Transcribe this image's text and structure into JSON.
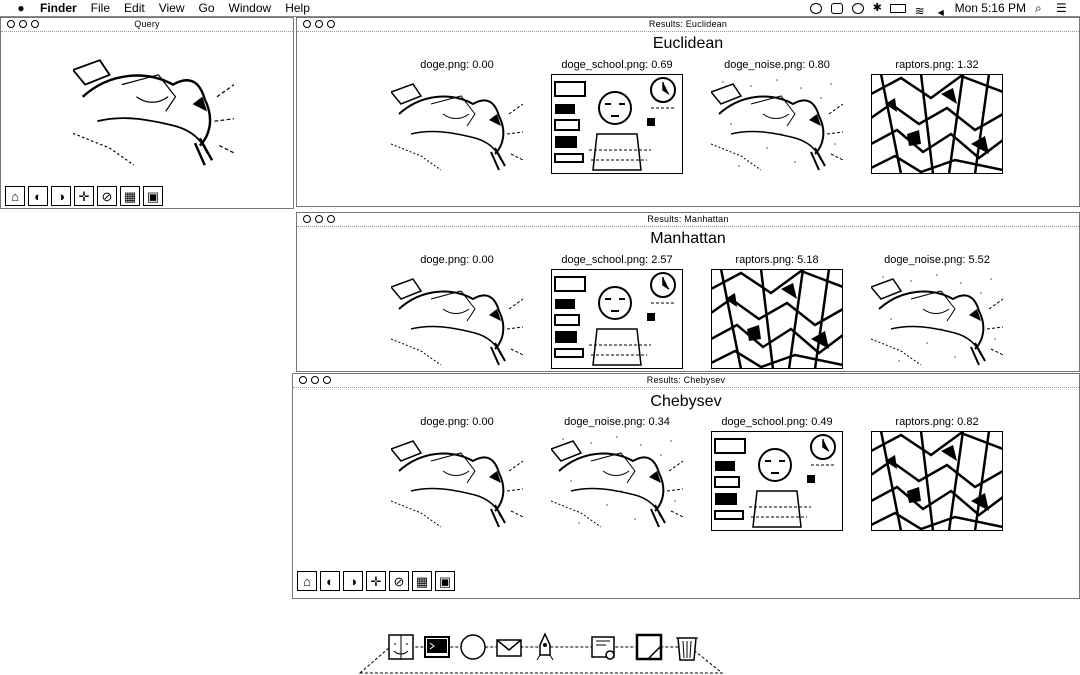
{
  "menubar": {
    "menus": [
      "Finder",
      "File",
      "Edit",
      "View",
      "Go",
      "Window",
      "Help"
    ],
    "clock": "Mon 5:16 PM",
    "status_icons": [
      "dropbox-icon",
      "copy-icon",
      "time-machine-icon",
      "bluetooth-icon",
      "battery-icon",
      "wifi-icon",
      "volume-icon",
      "spotlight-icon",
      "notification-list-icon"
    ]
  },
  "query_window": {
    "title": "Query",
    "image": "doge",
    "toolbar_icons": [
      "home-icon",
      "back-icon",
      "forward-icon",
      "pan-icon",
      "zoom-icon",
      "subplots-icon",
      "save-icon"
    ]
  },
  "euclidean_window": {
    "title": "Results: Euclidean",
    "heading": "Euclidean",
    "results": [
      {
        "label": "doge.png: 0.00",
        "image": "doge"
      },
      {
        "label": "doge_school.png: 0.69",
        "image": "doge_school"
      },
      {
        "label": "doge_noise.png: 0.80",
        "image": "doge_noise"
      },
      {
        "label": "raptors.png: 1.32",
        "image": "raptors"
      }
    ]
  },
  "manhattan_window": {
    "title": "Results: Manhattan",
    "heading": "Manhattan",
    "results": [
      {
        "label": "doge.png: 0.00",
        "image": "doge"
      },
      {
        "label": "doge_school.png: 2.57",
        "image": "doge_school"
      },
      {
        "label": "raptors.png: 5.18",
        "image": "raptors"
      },
      {
        "label": "doge_noise.png: 5.52",
        "image": "doge_noise"
      }
    ]
  },
  "chebysev_window": {
    "title": "Results: Chebysev",
    "heading": "Chebysev",
    "results": [
      {
        "label": "doge.png: 0.00",
        "image": "doge"
      },
      {
        "label": "doge_noise.png: 0.34",
        "image": "doge_noise"
      },
      {
        "label": "doge_school.png: 0.49",
        "image": "doge_school"
      },
      {
        "label": "raptors.png: 0.82",
        "image": "raptors"
      }
    ],
    "toolbar_icons": [
      "home-icon",
      "back-icon",
      "forward-icon",
      "pan-icon",
      "zoom-icon",
      "subplots-icon",
      "save-icon"
    ]
  },
  "dock": {
    "items": [
      "finder-icon",
      "terminal-icon",
      "safari-icon",
      "mail-icon",
      "launchpad-icon",
      "preview-icon",
      "textedit-icon",
      "trash-icon"
    ]
  }
}
